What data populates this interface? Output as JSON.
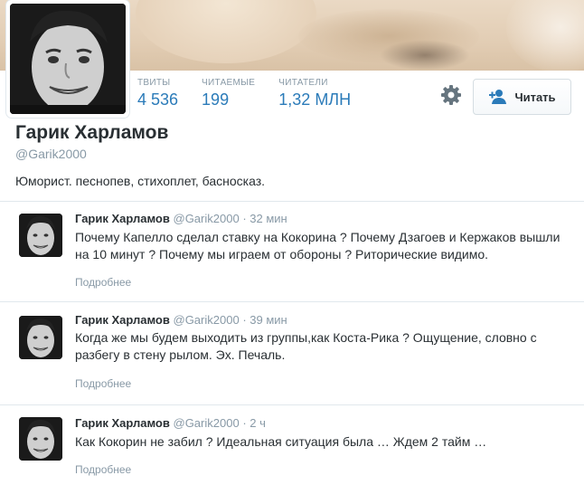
{
  "profile": {
    "name": "Гарик Харламов",
    "handle": "@Garik2000",
    "bio": "Юморист. песнопев, стихоплет, басносказ.",
    "stats": [
      {
        "label": "ТВИТЫ",
        "value": "4 536"
      },
      {
        "label": "ЧИТАЕМЫЕ",
        "value": "199"
      },
      {
        "label": "ЧИТАТЕЛИ",
        "value": "1,32 МЛН"
      }
    ],
    "follow_label": "Читать",
    "settings_icon": "gear-icon",
    "follow_icon": "add-user-icon"
  },
  "colors": {
    "accent": "#2b7bb9",
    "muted": "#8899a6",
    "text": "#292f33"
  },
  "tweets": [
    {
      "name": "Гарик Харламов",
      "handle": "@Garik2000",
      "time": "· 32 мин",
      "text": "Почему Капелло сделал ставку на Кокорина ? Почему Дзагоев и Кержаков вышли на 10 минут ? Почему мы играем от обороны ? Риторические видимо.",
      "more": "Подробнее"
    },
    {
      "name": "Гарик Харламов",
      "handle": "@Garik2000",
      "time": "· 39 мин",
      "text": "Когда же мы будем выходить из группы,как Коста-Рика ? Ощущение, словно с разбегу в стену рылом. Эх. Печаль.",
      "more": "Подробнее"
    },
    {
      "name": "Гарик Харламов",
      "handle": "@Garik2000",
      "time": "· 2 ч",
      "text": "Как Кокорин не забил ? Идеальная ситуация была … Ждем 2 тайм …",
      "more": "Подробнее"
    }
  ]
}
